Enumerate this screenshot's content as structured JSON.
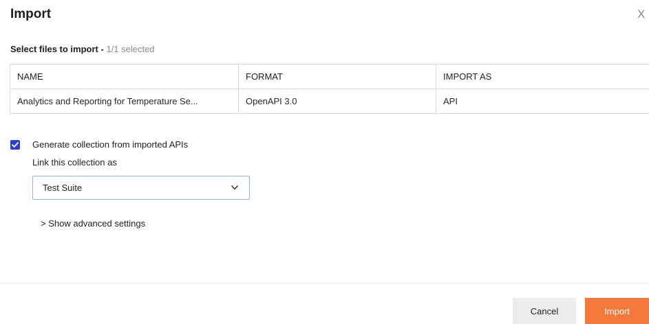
{
  "dialog": {
    "title": "Import",
    "close_label": "X"
  },
  "selection": {
    "label": "Select files to import -",
    "count": "1/1 selected"
  },
  "table": {
    "headers": [
      "NAME",
      "FORMAT",
      "IMPORT AS"
    ],
    "rows": [
      {
        "name": "Analytics and Reporting for Temperature Se...",
        "format": "OpenAPI 3.0",
        "import_as": "API"
      }
    ]
  },
  "options": {
    "generate_collection_label": "Generate collection from imported APIs",
    "generate_collection_checked": true,
    "link_label": "Link this collection as",
    "link_value": "Test Suite",
    "advanced_label": "> Show advanced settings"
  },
  "footer": {
    "cancel_label": "Cancel",
    "import_label": "Import"
  },
  "colors": {
    "accent": "#f5793b",
    "checkbox": "#2f3fcf"
  },
  "icons": {
    "checkbox": "check-icon",
    "dropdown": "chevron-down-icon"
  }
}
